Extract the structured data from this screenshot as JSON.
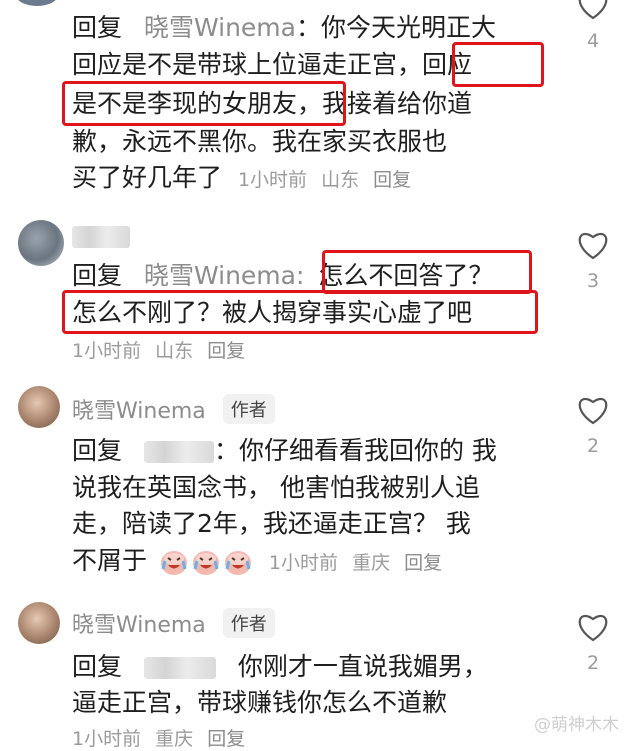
{
  "comments": [
    {
      "reply_prefix": "回复",
      "reply_target": "晓雪Winema",
      "line1": "：你今天光明正大",
      "line2": "回应是不是带球上位逼走正宫，回应",
      "line3": "是不是李现的女朋友，我接着给你道",
      "line4": "歉，永远不黑你。我在家买衣服也",
      "line5_text": "买了好几年了",
      "time": "1小时前",
      "location": "山东",
      "reply_label": "回复",
      "likes": "4"
    },
    {
      "reply_prefix": "回复",
      "reply_target": "晓雪Winema:",
      "line1": "怎么不回答了？",
      "line2": "怎么不刚了？被人揭穿事实心虚了吧",
      "time": "1小时前",
      "location": "山东",
      "reply_label": "回复",
      "likes": "3"
    },
    {
      "username": "晓雪Winema",
      "badge": "作者",
      "reply_prefix": "回复",
      "line1_suffix": "：你仔细看看我回你的 我",
      "line2": "说我在英国念书， 他害怕我被别人追",
      "line3": "走，陪读了2年，我还逼走正宫？ 我",
      "line4": "不屑于",
      "time": "1小时前",
      "location": "重庆",
      "reply_label": "回复",
      "likes": "2"
    },
    {
      "username": "晓雪Winema",
      "badge": "作者",
      "reply_prefix": "回复",
      "line1_suffix": "你刚才一直说我媚男，",
      "line2": "逼走正宫，带球赚钱你怎么不道歉",
      "time": "1小时前",
      "location": "重庆",
      "reply_label": "回复",
      "likes": "2"
    }
  ],
  "watermark": "@萌神木木",
  "colors": {
    "highlight_box": "#e0141b",
    "meta_gray": "#9b9b9b"
  },
  "icons": {
    "like": "heart-outline-icon",
    "emoji": "crying-laughing-emoji"
  }
}
